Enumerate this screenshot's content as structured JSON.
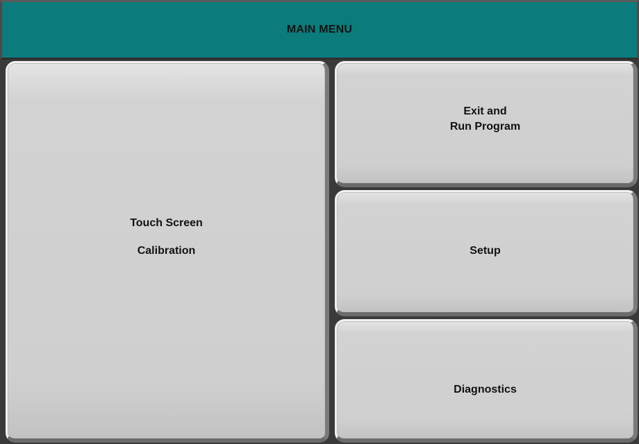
{
  "header": {
    "title": "MAIN MENU"
  },
  "buttons": {
    "touch_screen": {
      "line1": "Touch Screen",
      "line2": "Calibration"
    },
    "exit_run": {
      "line1": "Exit and",
      "line2": "Run Program"
    },
    "setup": {
      "label": "Setup"
    },
    "diagnostics": {
      "label": "Diagnostics"
    }
  },
  "colors": {
    "header_bg": "#0b7b7b",
    "button_face": "#d2d2d2",
    "text": "#111111"
  }
}
